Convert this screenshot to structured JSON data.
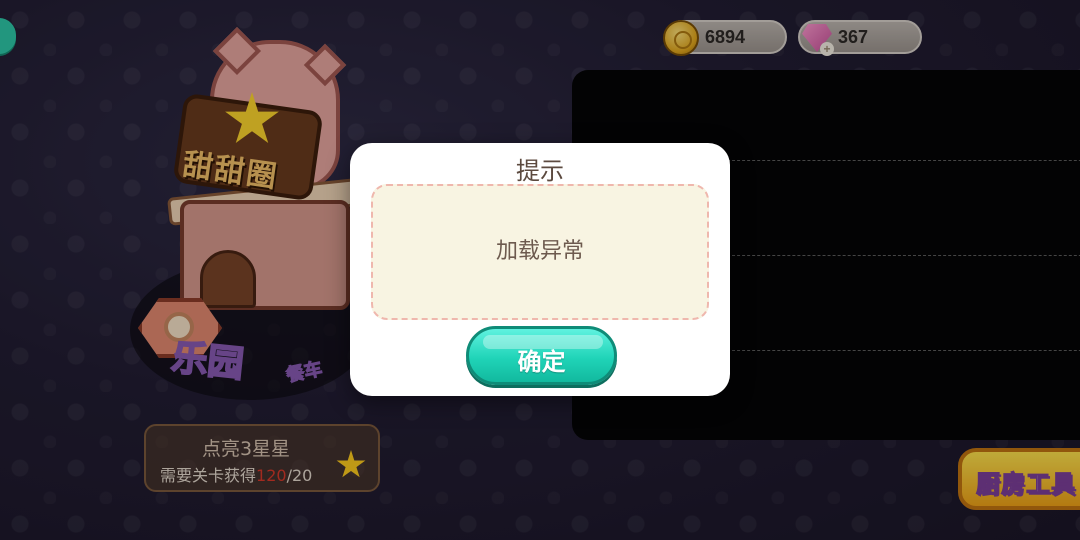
{
  "currency": {
    "coins": "6894",
    "gems": "367",
    "gem_add_glyph": "+"
  },
  "building": {
    "sign_text": "甜甜圈",
    "park_label": "乐园",
    "park_sub": "餐车"
  },
  "star_requirement": {
    "title": "点亮3星星",
    "prefix": "需要关卡获得",
    "current": "120",
    "separator_total": "/20"
  },
  "kitchen_button": {
    "label": "厨房工具"
  },
  "dialog": {
    "title": "提示",
    "message": "加载异常",
    "confirm_label": "确定"
  },
  "colors": {
    "confirm_button": "#20d4b8",
    "dialog_body_bg": "#f8f4e2",
    "dialog_border_dash": "#efb7ad",
    "star_count_red": "#d8382a",
    "kitchen_button": "#f0a318"
  }
}
